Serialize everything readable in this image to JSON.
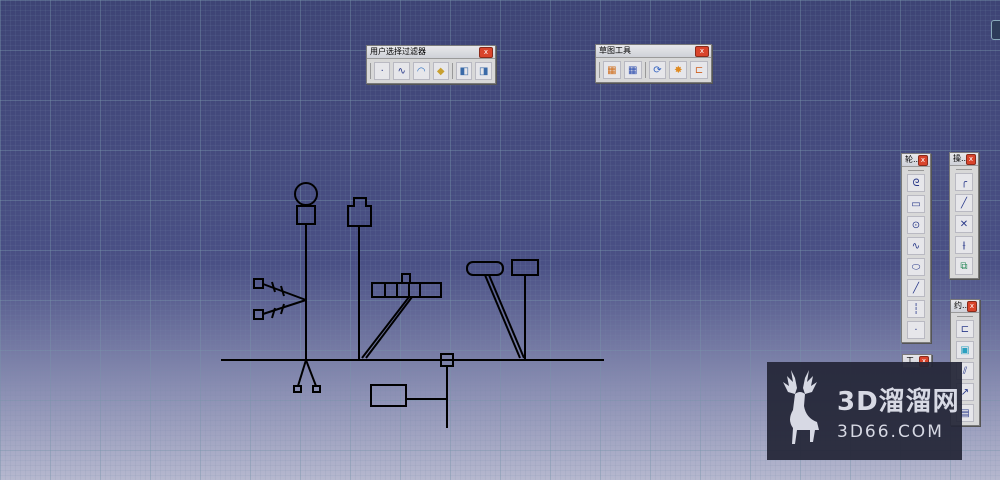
{
  "toolbars": {
    "user_filter": {
      "title": "用户选择过滤器",
      "close": "x",
      "icons": [
        "point-filter-icon",
        "curve-filter-icon",
        "surface-filter-icon",
        "volume-filter-icon",
        "feature-element-filter-icon",
        "geometry-element-filter-icon"
      ]
    },
    "sketch_tools": {
      "title": "草图工具",
      "close": "x",
      "icons": [
        "grid-icon",
        "snap-to-point-icon",
        "construction-element-icon",
        "geometrical-constraints-icon",
        "dimensional-constraints-icon"
      ]
    },
    "profile": {
      "title": "轮...",
      "close": "x",
      "icons": [
        "profile-icon",
        "rectangle-icon",
        "circle-icon",
        "spline-icon",
        "ellipse-icon",
        "line-icon",
        "axis-icon",
        "point-icon"
      ]
    },
    "operation": {
      "title": "操...",
      "close": "x",
      "icons": [
        "corner-icon",
        "chamfer-icon",
        "trim-icon",
        "mirror-icon",
        "project-3d-elements-icon"
      ]
    },
    "constraint": {
      "title": "约...",
      "close": "x",
      "icons": [
        "constraint-dialog-icon",
        "constraint-icon",
        "contact-constraint-icon",
        "fix-together-icon",
        "auto-constraint-icon"
      ]
    },
    "tools_small": {
      "title": "工...",
      "close": "x"
    }
  },
  "watermark": {
    "brand_cn": "3D溜溜网",
    "url": "3D66.COM"
  }
}
